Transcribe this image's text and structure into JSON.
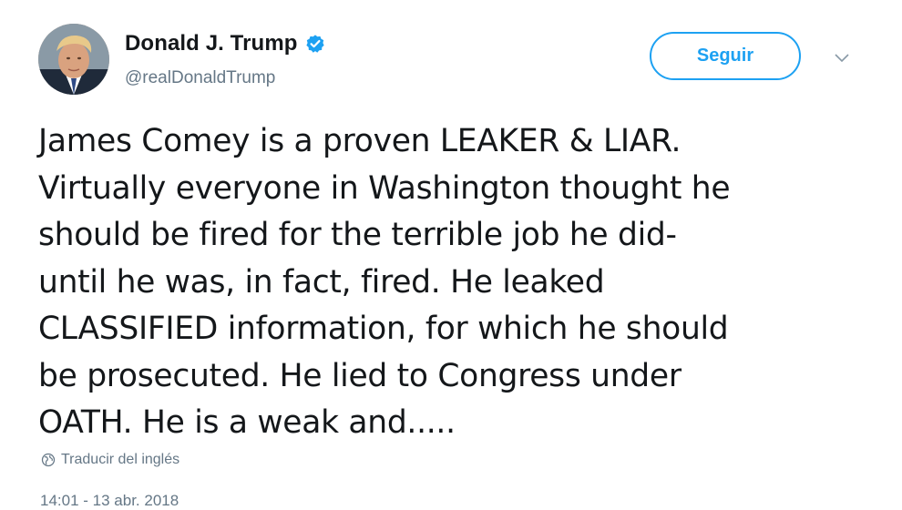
{
  "tweet": {
    "author": {
      "display_name": "Donald J. Trump",
      "handle": "@realDonaldTrump",
      "verified": true,
      "avatar_icon": "profile-photo"
    },
    "follow_button_label": "Seguir",
    "menu_icon": "chevron-down-icon",
    "text_lines": [
      "James Comey is a proven LEAKER & LIAR.",
      "Virtually everyone in Washington thought he",
      "should be fired for the terrible job he did-",
      "until he was, in fact, fired. He leaked",
      "CLASSIFIED information, for which he should",
      "be prosecuted. He lied to Congress under",
      "OATH. He is a weak and....."
    ],
    "translate_label": "Traducir del inglés",
    "timestamp": "14:01 - 13 abr. 2018"
  },
  "colors": {
    "accent": "#1da1f2",
    "secondary_text": "#657786",
    "primary_text": "#14171a"
  }
}
